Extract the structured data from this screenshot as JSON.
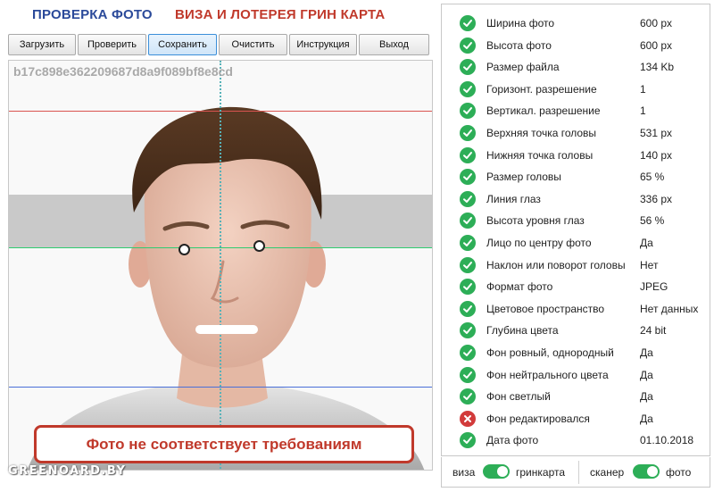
{
  "header": {
    "title_check": "ПРОВЕРКА ФОТО",
    "title_visa": "ВИЗА И ЛОТЕРЕЯ ГРИН КАРТА"
  },
  "toolbar": {
    "load": "Загрузить",
    "check": "Проверить",
    "save": "Сохранить",
    "clear": "Очистить",
    "instructions": "Инструкция",
    "exit": "Выход"
  },
  "photo": {
    "hash": "b17c898e362209687d8a9f089bf8e8cd",
    "warning": "Фото не соответствует требованиям",
    "watermark": "GREENOARD.BY"
  },
  "checks": [
    {
      "label": "Ширина фото",
      "value": "600 px",
      "status": "ok"
    },
    {
      "label": "Высота фото",
      "value": "600 px",
      "status": "ok"
    },
    {
      "label": "Размер файла",
      "value": "134 Kb",
      "status": "ok"
    },
    {
      "label": "Горизонт. разрешение",
      "value": "1",
      "status": "ok"
    },
    {
      "label": "Вертикал. разрешение",
      "value": "1",
      "status": "ok"
    },
    {
      "label": "Верхняя точка головы",
      "value": "531 px",
      "status": "ok"
    },
    {
      "label": "Нижняя точка головы",
      "value": "140 px",
      "status": "ok"
    },
    {
      "label": "Размер головы",
      "value": "65 %",
      "status": "ok"
    },
    {
      "label": "Линия глаз",
      "value": "336 px",
      "status": "ok"
    },
    {
      "label": "Высота уровня глаз",
      "value": "56 %",
      "status": "ok"
    },
    {
      "label": "Лицо по центру фото",
      "value": "Да",
      "status": "ok"
    },
    {
      "label": "Наклон или поворот головы",
      "value": "Нет",
      "status": "ok"
    },
    {
      "label": "Формат фото",
      "value": "JPEG",
      "status": "ok"
    },
    {
      "label": "Цветовое пространство",
      "value": "Нет данных",
      "status": "ok"
    },
    {
      "label": "Глубина цвета",
      "value": "24 bit",
      "status": "ok"
    },
    {
      "label": "Фон ровный, однородный",
      "value": "Да",
      "status": "ok"
    },
    {
      "label": "Фон нейтрального цвета",
      "value": "Да",
      "status": "ok"
    },
    {
      "label": "Фон светлый",
      "value": "Да",
      "status": "ok"
    },
    {
      "label": "Фон редактировался",
      "value": "Да",
      "status": "fail"
    },
    {
      "label": "Дата фото",
      "value": "01.10.2018",
      "status": "ok"
    }
  ],
  "toggles": {
    "left_off": "виза",
    "left_on": "гринкарта",
    "left_state": "on",
    "right_off": "сканер",
    "right_on": "фото",
    "right_state": "on"
  },
  "colors": {
    "ok": "#2dae57",
    "fail": "#d23b3b",
    "title_blue": "#2b4a9a",
    "title_red": "#c0392b",
    "guide_red": "#d9534f",
    "guide_green": "#2ecc71",
    "guide_blue": "#4a6fd8",
    "guide_center": "#57b2b8"
  }
}
